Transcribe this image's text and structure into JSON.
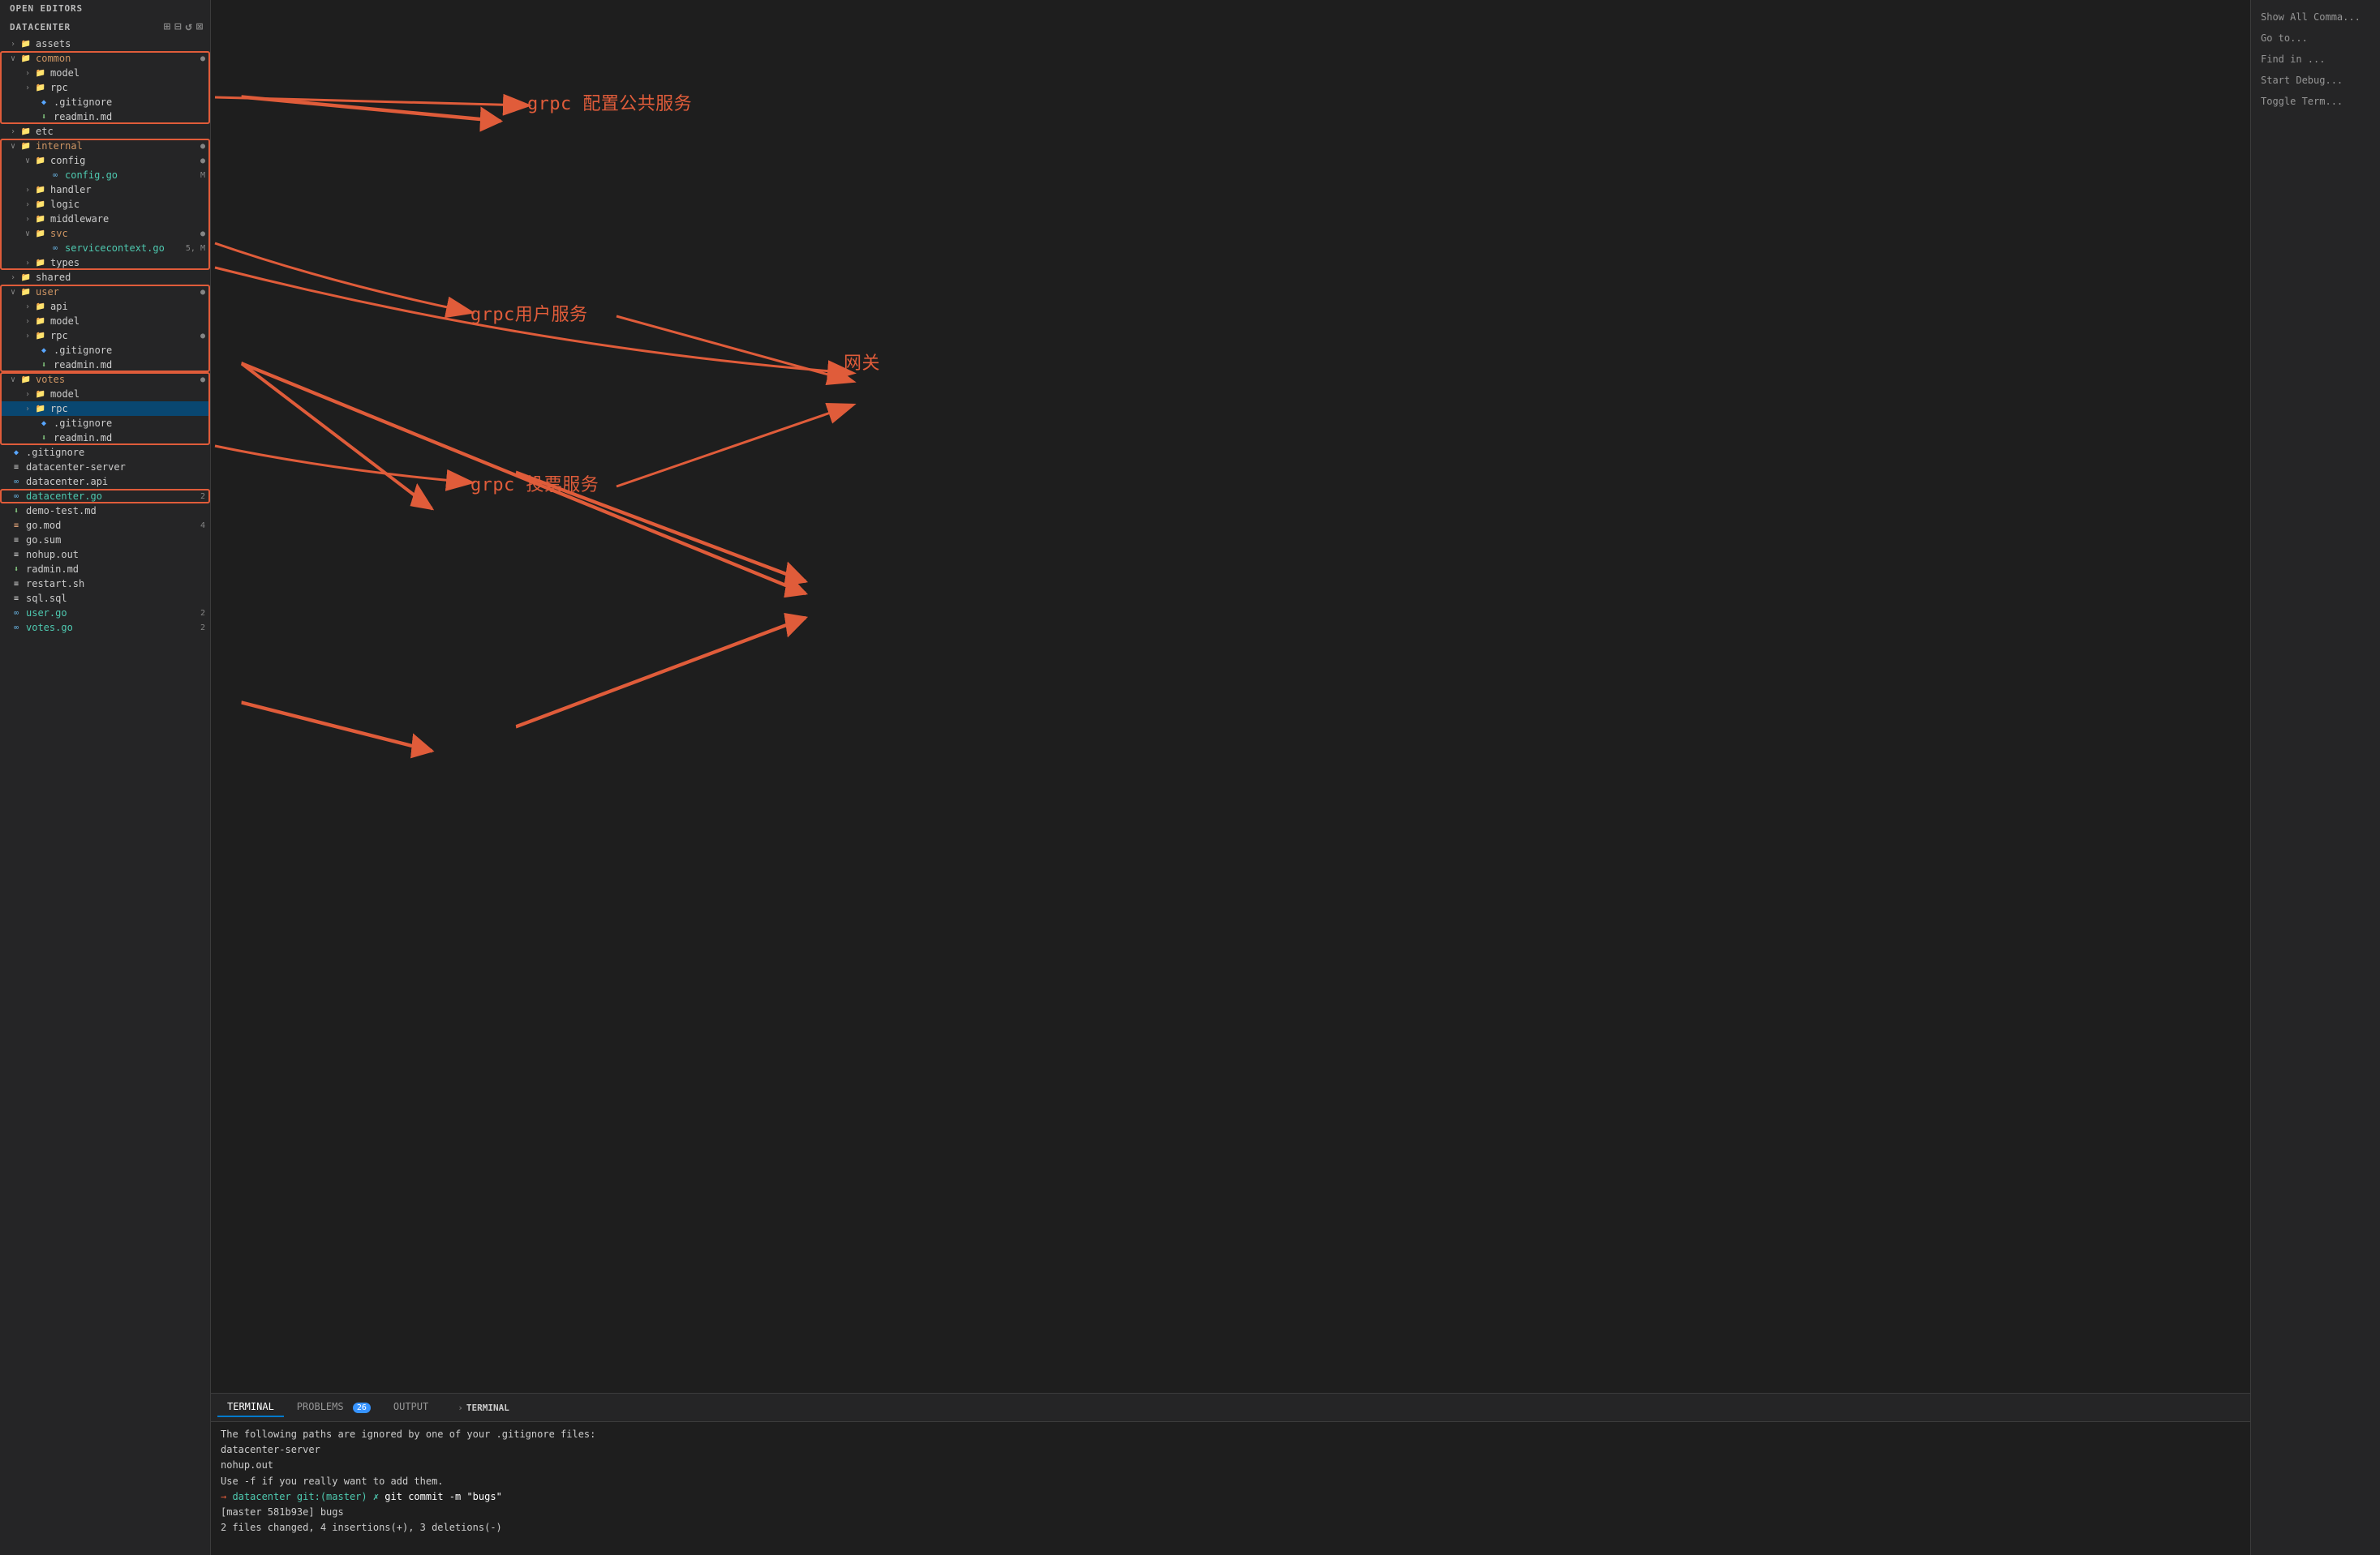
{
  "sidebar": {
    "open_editors_label": "OPEN EDITORS",
    "datacenter_label": "DATACENTER",
    "toolbar_icons": [
      "⊞",
      "⊟",
      "↺",
      "⊠"
    ],
    "tree": [
      {
        "id": "assets",
        "label": "assets",
        "type": "folder",
        "depth": 0,
        "open": false,
        "arrow": "›"
      },
      {
        "id": "common",
        "label": "common",
        "type": "folder",
        "depth": 0,
        "open": true,
        "arrow": "∨",
        "color": "orange",
        "badge": "●",
        "badge_class": "badge-modified"
      },
      {
        "id": "model",
        "label": "model",
        "type": "folder",
        "depth": 1,
        "open": false,
        "arrow": "›"
      },
      {
        "id": "rpc",
        "label": "rpc",
        "type": "folder",
        "depth": 1,
        "open": false,
        "arrow": "›"
      },
      {
        "id": "gitignore_common",
        "label": ".gitignore",
        "type": "gitignore",
        "depth": 1,
        "arrow": ""
      },
      {
        "id": "readmin_common",
        "label": "readmin.md",
        "type": "md",
        "depth": 1,
        "arrow": ""
      },
      {
        "id": "etc",
        "label": "etc",
        "type": "folder",
        "depth": 0,
        "open": false,
        "arrow": "›"
      },
      {
        "id": "internal",
        "label": "internal",
        "type": "folder",
        "depth": 0,
        "open": true,
        "arrow": "∨",
        "color": "orange",
        "badge": "●",
        "badge_class": "badge-modified"
      },
      {
        "id": "config",
        "label": "config",
        "type": "folder",
        "depth": 1,
        "open": true,
        "arrow": "∨",
        "badge": "●",
        "badge_class": "badge-modified"
      },
      {
        "id": "config_go",
        "label": "config.go",
        "type": "go",
        "depth": 2,
        "arrow": "",
        "badge": "M",
        "badge_class": "badge-m"
      },
      {
        "id": "handler",
        "label": "handler",
        "type": "folder",
        "depth": 1,
        "open": false,
        "arrow": "›"
      },
      {
        "id": "logic",
        "label": "logic",
        "type": "folder",
        "depth": 1,
        "open": false,
        "arrow": "›"
      },
      {
        "id": "middleware",
        "label": "middleware",
        "type": "folder",
        "depth": 1,
        "open": false,
        "arrow": "›"
      },
      {
        "id": "svc",
        "label": "svc",
        "type": "folder",
        "depth": 1,
        "open": true,
        "arrow": "∨",
        "color": "orange",
        "badge": "●",
        "badge_class": "badge-modified"
      },
      {
        "id": "servicecontext_go",
        "label": "servicecontext.go",
        "type": "go",
        "depth": 2,
        "arrow": "",
        "badge": "5, M",
        "badge_class": "badge-m"
      },
      {
        "id": "types",
        "label": "types",
        "type": "folder",
        "depth": 1,
        "open": false,
        "arrow": "›"
      },
      {
        "id": "shared",
        "label": "shared",
        "type": "folder",
        "depth": 0,
        "open": false,
        "arrow": "›"
      },
      {
        "id": "user",
        "label": "user",
        "type": "folder",
        "depth": 0,
        "open": true,
        "arrow": "∨",
        "color": "orange",
        "badge": "●",
        "badge_class": "badge-modified"
      },
      {
        "id": "api_user",
        "label": "api",
        "type": "folder",
        "depth": 1,
        "open": false,
        "arrow": "›"
      },
      {
        "id": "model_user",
        "label": "model",
        "type": "folder",
        "depth": 1,
        "open": false,
        "arrow": "›"
      },
      {
        "id": "rpc_user",
        "label": "rpc",
        "type": "folder",
        "depth": 1,
        "open": false,
        "arrow": "›",
        "badge": "●",
        "badge_class": "badge-modified"
      },
      {
        "id": "gitignore_user",
        "label": ".gitignore",
        "type": "gitignore",
        "depth": 1,
        "arrow": ""
      },
      {
        "id": "readmin_user",
        "label": "readmin.md",
        "type": "md",
        "depth": 1,
        "arrow": ""
      },
      {
        "id": "votes",
        "label": "votes",
        "type": "folder",
        "depth": 0,
        "open": true,
        "arrow": "∨",
        "color": "orange",
        "badge": "●",
        "badge_class": "badge-modified"
      },
      {
        "id": "model_votes",
        "label": "model",
        "type": "folder",
        "depth": 1,
        "open": false,
        "arrow": "›"
      },
      {
        "id": "rpc_votes",
        "label": "rpc",
        "type": "folder",
        "depth": 1,
        "open": false,
        "arrow": "›",
        "selected": true
      },
      {
        "id": "gitignore_votes",
        "label": ".gitignore",
        "type": "gitignore",
        "depth": 1,
        "arrow": ""
      },
      {
        "id": "readmin_votes",
        "label": "readmin.md",
        "type": "md",
        "depth": 1,
        "arrow": ""
      },
      {
        "id": "gitignore_root",
        "label": ".gitignore",
        "type": "gitignore",
        "depth": 0,
        "arrow": ""
      },
      {
        "id": "datacenter_server",
        "label": "datacenter-server",
        "type": "file",
        "depth": 0,
        "arrow": ""
      },
      {
        "id": "datacenter_api",
        "label": "datacenter.api",
        "type": "api",
        "depth": 0,
        "arrow": ""
      },
      {
        "id": "datacenter_go",
        "label": "datacenter.go",
        "type": "go",
        "depth": 0,
        "arrow": "",
        "badge": "2",
        "badge_class": "badge-num",
        "highlighted": true
      },
      {
        "id": "demo_test_md",
        "label": "demo-test.md",
        "type": "md",
        "depth": 0,
        "arrow": ""
      },
      {
        "id": "go_mod",
        "label": "go.mod",
        "type": "mod",
        "depth": 0,
        "arrow": "",
        "badge": "4",
        "badge_class": "badge-num"
      },
      {
        "id": "go_sum",
        "label": "go.sum",
        "type": "sum",
        "depth": 0,
        "arrow": ""
      },
      {
        "id": "nohup_out",
        "label": "nohup.out",
        "type": "file",
        "depth": 0,
        "arrow": ""
      },
      {
        "id": "radmin_md",
        "label": "radmin.md",
        "type": "md",
        "depth": 0,
        "arrow": ""
      },
      {
        "id": "restart_sh",
        "label": "restart.sh",
        "type": "file",
        "depth": 0,
        "arrow": ""
      },
      {
        "id": "sql_sql",
        "label": "sql.sql",
        "type": "file",
        "depth": 0,
        "arrow": ""
      },
      {
        "id": "user_go",
        "label": "user.go",
        "type": "go",
        "depth": 0,
        "arrow": "",
        "badge": "2",
        "badge_class": "badge-num"
      },
      {
        "id": "votes_go",
        "label": "votes.go",
        "type": "go",
        "depth": 0,
        "arrow": "",
        "badge": "2",
        "badge_class": "badge-num"
      }
    ]
  },
  "annotations": {
    "grpc_common": "grpc 配置公共服务",
    "grpc_user": "grpc用户服务",
    "gateway": "网关",
    "grpc_votes": "grpc 投票服务"
  },
  "terminal": {
    "tabs": [
      {
        "label": "TERMINAL",
        "active": true
      },
      {
        "label": "PROBLEMS",
        "badge": "26",
        "active": false
      },
      {
        "label": "OUTPUT",
        "active": false
      }
    ],
    "terminal_header": "TERMINAL",
    "lines": [
      "The following paths are ignored by one of your .gitignore files:",
      "  datacenter-server",
      "  nohup.out",
      "Use -f if you really want to add them.",
      "→ datacenter git:(master) ✗ git commit -m \"bugs\"",
      "[master 581b93e] bugs",
      "2 files changed, 4 insertions(+), 3 deletions(-)"
    ]
  },
  "right_panel": {
    "items": [
      "Show All Comma...",
      "Go to...",
      "Find in ...",
      "Start Debug...",
      "Toggle Term..."
    ]
  }
}
